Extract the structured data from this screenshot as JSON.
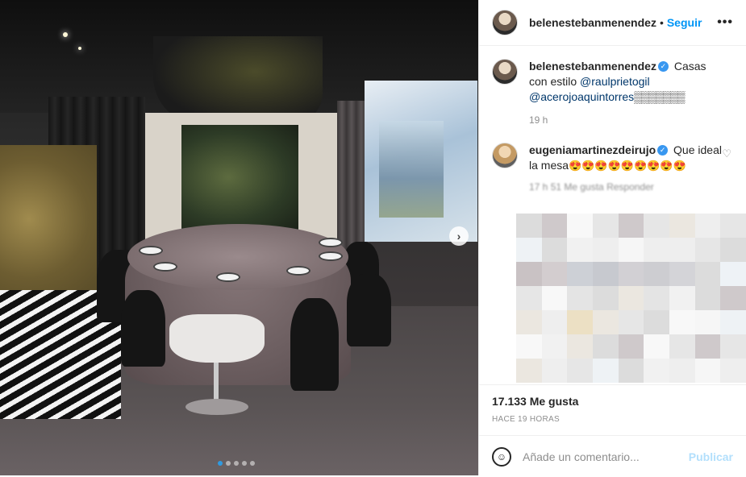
{
  "post": {
    "username": "belenestebanmenendez",
    "follow_label": "Seguir",
    "separator": "•",
    "more_icon": "•••"
  },
  "caption": {
    "username": "belenestebanmenendez",
    "text": "Casas con estilo",
    "mentions": [
      "@raulprietogil",
      "@acerojoaquintorres"
    ],
    "blocks": "▒▒▒▒▒▒▒",
    "time": "19 h"
  },
  "comment1": {
    "username": "eugeniamartinezdeirujo",
    "text": "Que ideal la mesa",
    "emojis": "😍😍😍😍😍😍😍😍😍",
    "meta": "17 h   51 Me gusta   Responder"
  },
  "stats": {
    "likes": "17.133 Me gusta",
    "time": "HACE 19 HORAS"
  },
  "composer": {
    "placeholder": "Añade un comentario...",
    "publish_label": "Publicar"
  },
  "carousel": {
    "next_icon": "›",
    "dots": 5,
    "active_index": 0
  },
  "colors": {
    "link_blue": "#0095f6",
    "verified_blue": "#3897f0",
    "publish_disabled": "#b2dffc"
  }
}
